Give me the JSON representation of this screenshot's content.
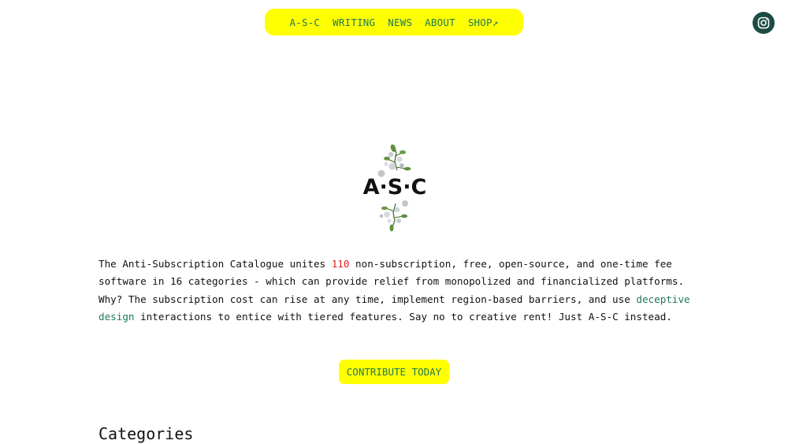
{
  "nav": {
    "items": [
      {
        "label": "A-S-C"
      },
      {
        "label": "WRITING"
      },
      {
        "label": "NEWS"
      },
      {
        "label": "ABOUT"
      },
      {
        "label": "SHOP↗"
      }
    ]
  },
  "social": {
    "icon": "instagram-icon"
  },
  "logo": {
    "text": "A·S·C"
  },
  "intro": {
    "part1": "The Anti-Subscription Catalogue unites ",
    "count": "110",
    "part2": " non-subscription, free, open-source, and one-time fee software in 16 categories - which can provide relief from monopolized and financialized platforms. Why? The subscription cost can rise at any time, implement region-based barriers, and use ",
    "link_text": "deceptive design",
    "part3": " interactions to entice with tiered features. Say no to creative rent! Just A-S-C instead."
  },
  "cta": {
    "label": "CONTRIBUTE TODAY"
  },
  "categories": {
    "title": "Categories"
  },
  "colors": {
    "nav_bg": "#ffff00",
    "link_green": "#1f7a55",
    "count_red": "#e02020",
    "insta_bg": "#1c4c44"
  }
}
